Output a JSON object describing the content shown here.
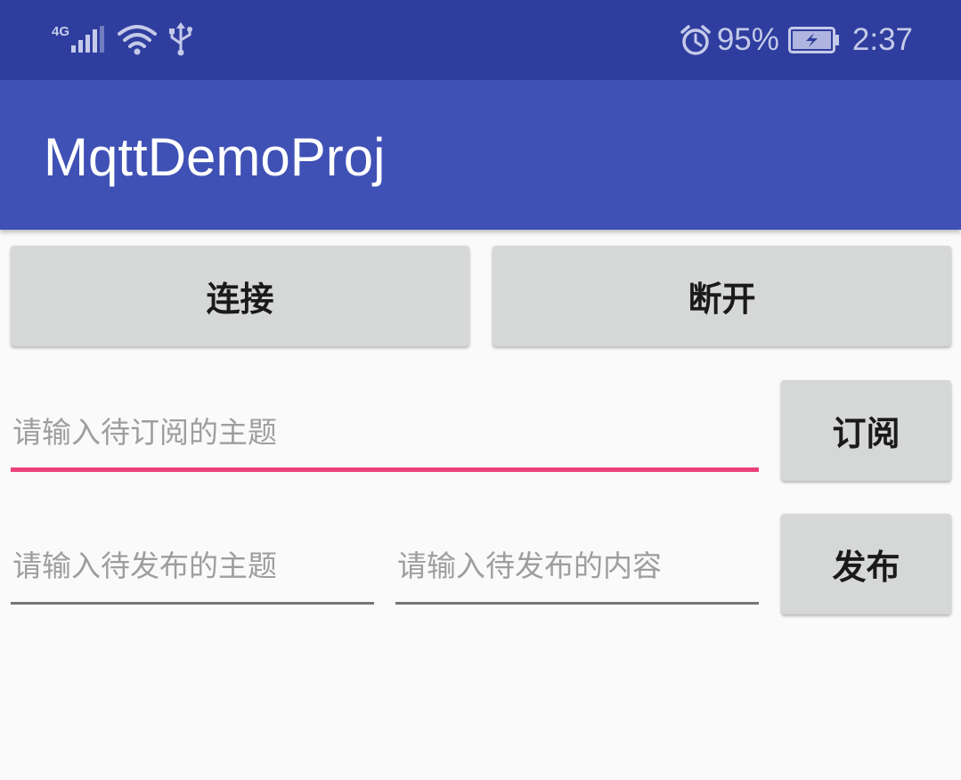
{
  "status_bar": {
    "network_type": "4G",
    "battery_percent": "95%",
    "time": "2:37",
    "icons": [
      "signal-icon",
      "wifi-icon",
      "usb-icon",
      "alarm-icon",
      "battery-charging-icon"
    ]
  },
  "app_bar": {
    "title": "MqttDemoProj"
  },
  "connection": {
    "connect_label": "连接",
    "disconnect_label": "断开"
  },
  "subscribe": {
    "topic_placeholder": "请输入待订阅的主题",
    "topic_value": "",
    "button_label": "订阅"
  },
  "publish": {
    "topic_placeholder": "请输入待发布的主题",
    "topic_value": "",
    "content_placeholder": "请输入待发布的内容",
    "content_value": "",
    "button_label": "发布"
  },
  "colors": {
    "status_bar": "#2f3e9e",
    "app_bar": "#3f51b5",
    "accent": "#ec407a",
    "button_bg": "#d6d7d7"
  }
}
